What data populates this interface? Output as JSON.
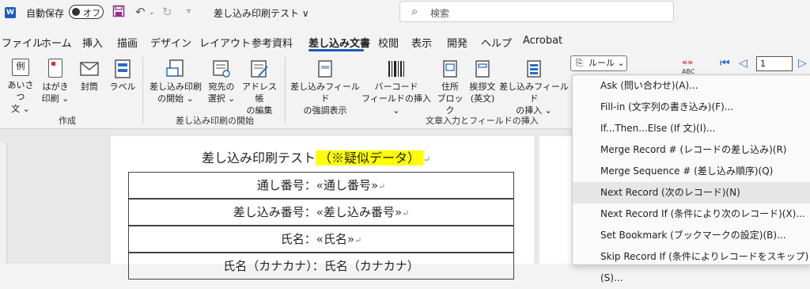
{
  "titlebar": {
    "logo": "W",
    "autosave_label": "自動保存",
    "toggle_label": "オフ",
    "save_icon": "save-icon",
    "undo_icon": "undo-icon",
    "redo_icon": "redo-icon",
    "customize_icon": "customize-qat-icon",
    "doc_title": "差し込み印刷テスト ∨",
    "search_placeholder": "検索"
  },
  "tabs": [
    "ファイル",
    "ホーム",
    "挿入",
    "描画",
    "デザイン",
    "レイアウト",
    "参考資料",
    "差し込み文書",
    "校閲",
    "表示",
    "開発",
    "ヘルプ",
    "Acrobat"
  ],
  "active_tab": "差し込み文書",
  "ribbon": {
    "create": {
      "label": "作成",
      "buttons": [
        {
          "l1": "あいさつ",
          "l2": "文 ⌄",
          "icon": "greeting-icon"
        },
        {
          "l1": "はがき",
          "l2": "印刷 ⌄",
          "icon": "postcard-icon"
        },
        {
          "l1": "封筒",
          "l2": "",
          "icon": "envelope-icon"
        },
        {
          "l1": "ラベル",
          "l2": "",
          "icon": "label-icon"
        }
      ]
    },
    "start": {
      "label": "差し込み印刷の開始",
      "buttons": [
        {
          "l1": "差し込み印刷",
          "l2": "の開始 ⌄",
          "icon": "start-merge-icon"
        },
        {
          "l1": "宛先の",
          "l2": "選択 ⌄",
          "icon": "select-recipients-icon"
        },
        {
          "l1": "アドレス帳",
          "l2": "の編集",
          "icon": "edit-list-icon"
        }
      ]
    },
    "fields": {
      "label": "文章入力とフィールドの挿入",
      "buttons": [
        {
          "l1": "差し込みフィールド",
          "l2": "の強調表示",
          "icon": "highlight-fields-icon"
        },
        {
          "l1": "バーコード",
          "l2": "フィールドの挿入 ⌄",
          "icon": "barcode-icon"
        },
        {
          "l1": "住所",
          "l2": "ブロック",
          "icon": "address-block-icon"
        },
        {
          "l1": "挨拶文",
          "l2": "(英文)",
          "icon": "greeting-line-icon"
        },
        {
          "l1": "差し込みフィールド",
          "l2": "の挿入 ⌄",
          "icon": "insert-field-icon"
        }
      ],
      "rules_button": "ルール ⌄"
    },
    "preview_label": "«»",
    "abc_label": "ABC",
    "record_number": "1"
  },
  "document": {
    "title": "差し込み印刷テスト",
    "title_highlight": "（※疑似データ）",
    "para_mark": "↵",
    "rows": [
      "通し番号：«通し番号»",
      "差し込み番号：«差し込み番号»",
      "氏名：«氏名»",
      "氏名（カナカナ）：氏名（カナカナ）"
    ]
  },
  "rules_menu": [
    "Ask (問い合わせ)(A)...",
    "Fill-in (文字列の書き込み)(F)...",
    "If...Then...Else (If 文)(I)...",
    "Merge Record # (レコードの差し込み)(R)",
    "Merge Sequence # (差し込み順序)(Q)",
    "Next Record (次のレコード)(N)",
    "Next Record If (条件により次のレコード)(X)...",
    "Set Bookmark (ブックマークの設定)(B)...",
    "Skip Record If (条件によりレコードをスキップ)(S)..."
  ],
  "highlighted_menu_index": 5,
  "colors": {
    "accent": "#185abd",
    "highlight": "#ffff00",
    "save": "#9b2a8f"
  }
}
